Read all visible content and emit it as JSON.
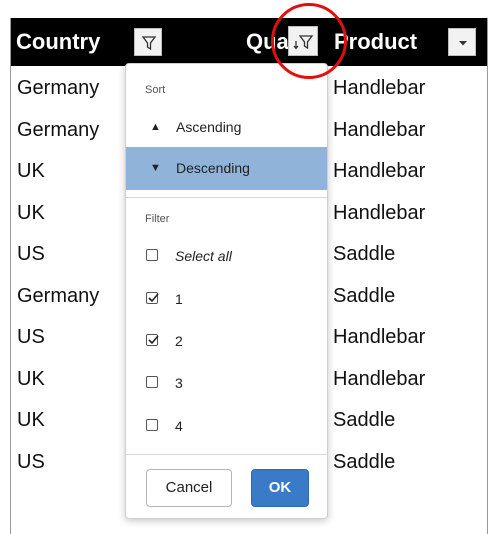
{
  "table": {
    "columns": [
      {
        "label": "Country",
        "control": "filter-icon"
      },
      {
        "label": "Quarter",
        "control": "filter-active-icon"
      },
      {
        "label": "Product",
        "control": "chevron-down-icon"
      }
    ],
    "rows": [
      {
        "country": "Germany",
        "product": "Handlebar"
      },
      {
        "country": "Germany",
        "product": "Handlebar"
      },
      {
        "country": "UK",
        "product": "Handlebar"
      },
      {
        "country": "UK",
        "product": "Handlebar"
      },
      {
        "country": "US",
        "product": "Saddle"
      },
      {
        "country": "Germany",
        "product": "Saddle"
      },
      {
        "country": "US",
        "product": "Handlebar"
      },
      {
        "country": "UK",
        "product": "Handlebar"
      },
      {
        "country": "UK",
        "product": "Saddle"
      },
      {
        "country": "US",
        "product": "Saddle"
      }
    ]
  },
  "popup": {
    "sort_title": "Sort",
    "sort_options": [
      {
        "label": "Ascending",
        "icon": "triangle-up-icon",
        "active": false
      },
      {
        "label": "Descending",
        "icon": "triangle-down-icon",
        "active": true
      }
    ],
    "filter_title": "Filter",
    "filter_options": [
      {
        "label": "Select all",
        "checked": false,
        "italic": true
      },
      {
        "label": "1",
        "checked": true
      },
      {
        "label": "2",
        "checked": true
      },
      {
        "label": "3",
        "checked": false
      },
      {
        "label": "4",
        "checked": false
      }
    ],
    "cancel_label": "Cancel",
    "ok_label": "OK"
  },
  "colors": {
    "header_bg": "#000000",
    "selected_bg": "#8fb3d9",
    "ok_button": "#3a7bc8",
    "highlight_circle": "#e01010"
  }
}
